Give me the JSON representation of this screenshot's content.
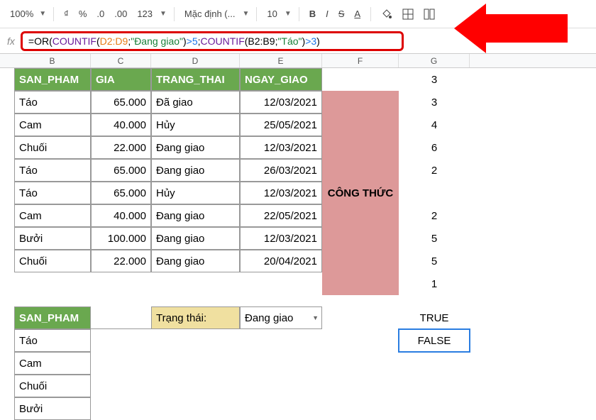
{
  "toolbar": {
    "zoom": "100%",
    "currency": "₫",
    "percent": "%",
    "dec_dec": ".0",
    "dec_inc": ".00",
    "num_fmt": "123",
    "font": "Mặc định (...",
    "font_size": "10"
  },
  "formula": {
    "fx": "fx",
    "eq": "=",
    "or": "OR",
    "countif1": "COUNTIF",
    "range1": "D2:D9",
    "str1": "\"Đang giao\"",
    "gt5": ">5",
    "countif2": "COUNTIF",
    "range2": "B2:B9",
    "str2": "\"Táo\"",
    "gt3": ">3"
  },
  "cols": {
    "b": "B",
    "c": "C",
    "d": "D",
    "e": "E",
    "f": "F",
    "g": "G"
  },
  "headers": {
    "san_pham": "SAN_PHAM",
    "gia": "GIA",
    "trang_thai": "TRANG_THAI",
    "ngay_giao": "NGAY_GIAO"
  },
  "rows": [
    {
      "sp": "Táo",
      "gia": "65.000",
      "tt": "Đã giao",
      "ng": "12/03/2021",
      "g": "3"
    },
    {
      "sp": "Cam",
      "gia": "40.000",
      "tt": "Hủy",
      "ng": "25/05/2021",
      "g": "4"
    },
    {
      "sp": "Chuối",
      "gia": "22.000",
      "tt": "Đang giao",
      "ng": "12/03/2021",
      "g": "6"
    },
    {
      "sp": "Táo",
      "gia": "65.000",
      "tt": "Đang giao",
      "ng": "26/03/2021",
      "g": "2"
    },
    {
      "sp": "Táo",
      "gia": "65.000",
      "tt": "Hủy",
      "ng": "12/03/2021",
      "g": ""
    },
    {
      "sp": "Cam",
      "gia": "40.000",
      "tt": "Đang giao",
      "ng": "22/05/2021",
      "g": "2"
    },
    {
      "sp": "Bưởi",
      "gia": "100.000",
      "tt": "Đang giao",
      "ng": "12/03/2021",
      "g": "5"
    },
    {
      "sp": "Chuối",
      "gia": "22.000",
      "tt": "Đang giao",
      "ng": "20/04/2021",
      "g": "5"
    }
  ],
  "merged_label": "CÔNG THỨC",
  "header_g_first": "3",
  "filter": {
    "label": "Trạng thái:",
    "value": "Đang giao"
  },
  "bottom": {
    "header": "SAN_PHAM",
    "items": [
      "Táo",
      "Cam",
      "Chuối",
      "Bưởi"
    ],
    "g_extra": [
      "1",
      "TRUE",
      "FALSE"
    ]
  }
}
